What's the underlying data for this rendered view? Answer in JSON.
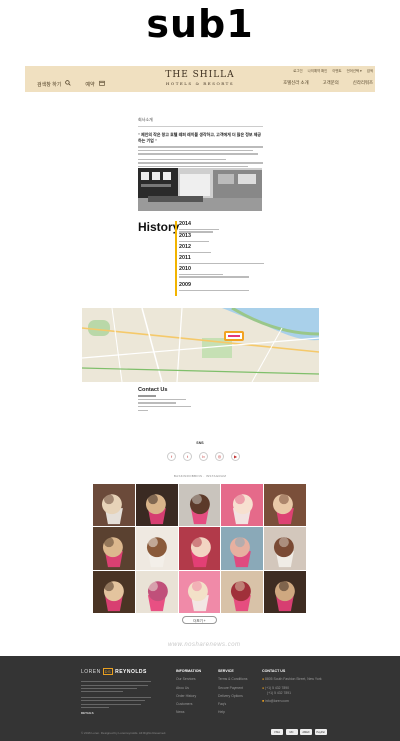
{
  "page_label": "sub1",
  "header": {
    "util_links": [
      "로그인",
      "나의예약 확인",
      "이벤트",
      "언어선택 ▾",
      "검색"
    ],
    "left_search_label": "검색창 하기",
    "left_reserve_label": "예약",
    "brand_line1": "THE SHILLA",
    "brand_line2": "HOTELS & RESORTS",
    "menu": [
      "호텔신라 소개",
      "고객문의",
      "신라리워즈"
    ]
  },
  "about": {
    "section_title": "회사소개",
    "headline": "\" 제안의 작은 창고 호텔 레퍼 레이블 생각하고, 고객에게 더 많은 정보 제공하는 기업 \""
  },
  "history": {
    "title": "History",
    "years": [
      "2014",
      "2013",
      "2012",
      "2011",
      "2010",
      "2009"
    ]
  },
  "contact": {
    "title": "Contact Us"
  },
  "sns": {
    "label": "SNS",
    "icons": [
      "facebook-icon",
      "twitter-icon",
      "blog-icon",
      "instagram-icon",
      "youtube-icon"
    ],
    "icon_glyphs": [
      "f",
      "t",
      "b",
      "◎",
      "▶"
    ]
  },
  "instagram": {
    "label": "BASKINROBBINS · INSTAGRAM",
    "tiles": [
      {
        "bg": "#6b4a3a",
        "fg": "#e7d3b8"
      },
      {
        "bg": "#3a2a22",
        "fg": "#d9b48a"
      },
      {
        "bg": "#c9c4bd",
        "fg": "#5c3a2a"
      },
      {
        "bg": "#e56a8a",
        "fg": "#f7e0d0"
      },
      {
        "bg": "#7a4f3a",
        "fg": "#e9c9a8"
      },
      {
        "bg": "#5a4130",
        "fg": "#dcb88e"
      },
      {
        "bg": "#efe9e1",
        "fg": "#8a5a3a"
      },
      {
        "bg": "#b23a4a",
        "fg": "#f2d4c2"
      },
      {
        "bg": "#8aa9b8",
        "fg": "#e7b0a0"
      },
      {
        "bg": "#d3c7bc",
        "fg": "#7a4a34"
      },
      {
        "bg": "#4a3424",
        "fg": "#e4c49e"
      },
      {
        "bg": "#e9e2d6",
        "fg": "#c0507a"
      },
      {
        "bg": "#f08aa8",
        "fg": "#f3e1c8"
      },
      {
        "bg": "#d8c2a8",
        "fg": "#a0303a"
      },
      {
        "bg": "#3e2c22",
        "fg": "#cfa880"
      }
    ]
  },
  "more_button": "더보기 +",
  "watermark": "www.nosharenews.com",
  "footer": {
    "brand_left": "LOREN",
    "brand_badge": "DS",
    "brand_right": "REYNOLDS",
    "details_heading": "DETAILS",
    "information": {
      "heading": "INFORMATION",
      "items": [
        "Our Services",
        "Abou Us",
        "Order History",
        "Customers",
        "News"
      ]
    },
    "service": {
      "heading": "SERVICE",
      "items": [
        "Terms & Conditions",
        "Secure Payment",
        "Delivery Options",
        "Faq's",
        "Help"
      ]
    },
    "contact": {
      "heading": "CONTACT US",
      "lines": [
        "8805 South Fashion Street, New York",
        "(+1) 5 432 7890",
        "(+1) 5 432 7891",
        "info@loren.com"
      ]
    },
    "copyright": "© 2016 Loren. Designed by Lorenreynolds. All Rights Reserved.",
    "payments": [
      "VISA",
      "MC",
      "AMEX",
      "PayPal"
    ]
  }
}
